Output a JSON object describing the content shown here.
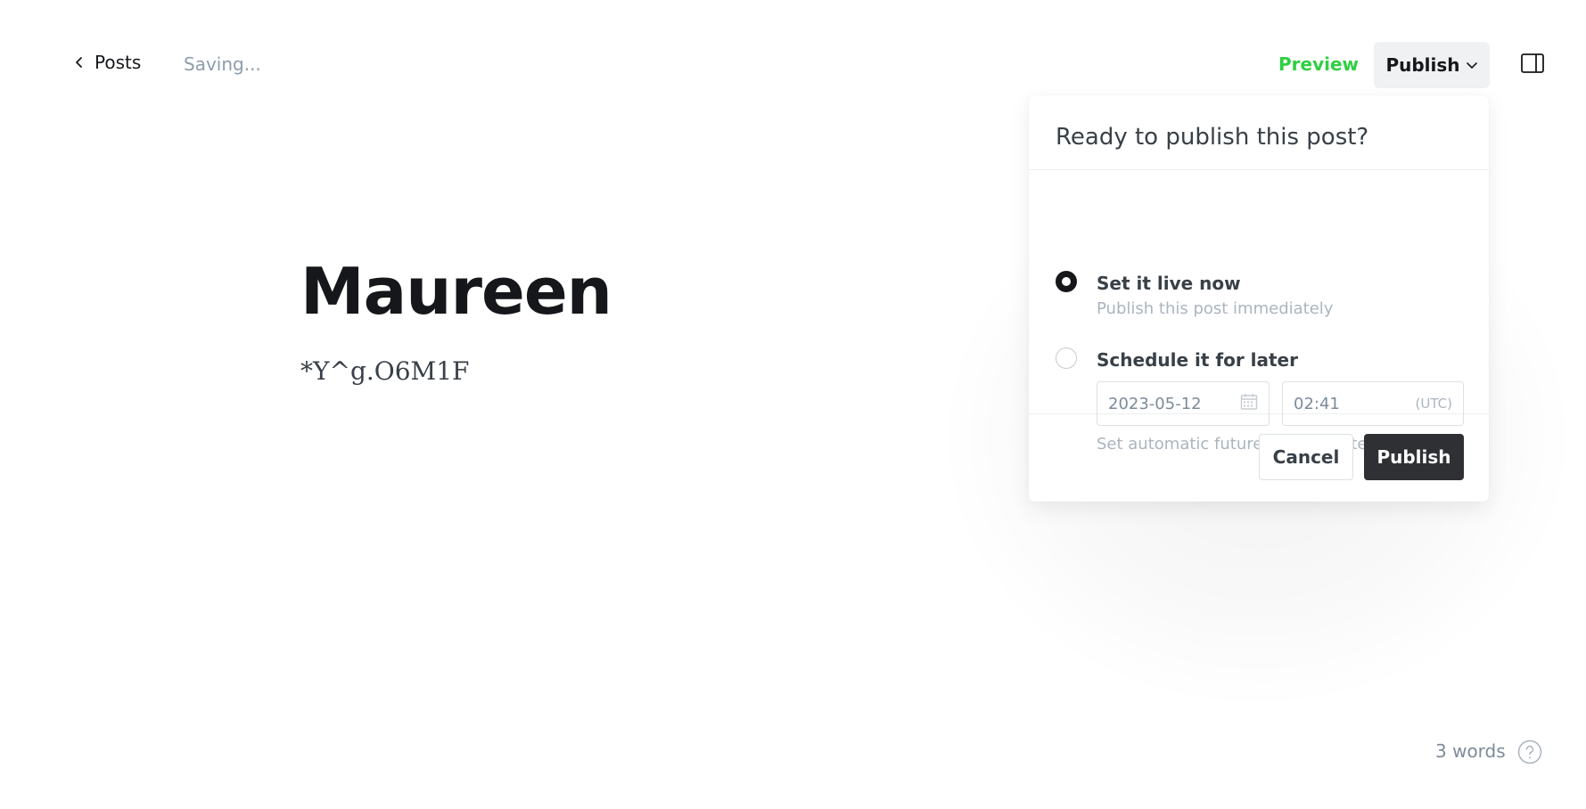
{
  "header": {
    "back_label": "Posts",
    "status": "Saving...",
    "preview_label": "Preview",
    "publish_label": "Publish"
  },
  "editor": {
    "title": "Maureen",
    "body": "*Y^g.O6M1F"
  },
  "publish_menu": {
    "heading": "Ready to publish this post?",
    "options": [
      {
        "label": "Set it live now",
        "description": "Publish this post immediately",
        "selected": true
      },
      {
        "label": "Schedule it for later",
        "description": "Set automatic future publish date",
        "selected": false
      }
    ],
    "date_value": "2023-05-12",
    "time_value": "02:41",
    "timezone": "(UTC)",
    "cancel_label": "Cancel",
    "confirm_label": "Publish"
  },
  "footer": {
    "word_count": "3 words"
  },
  "colors": {
    "accent_green": "#30cf43",
    "dark_button": "#2e3034",
    "muted_text": "#8e9cac"
  },
  "icons": {
    "back": "chevron-left-icon",
    "caret": "chevron-down-icon",
    "sidebar": "sidebar-panel-icon",
    "calendar": "calendar-icon",
    "help": "question-circle-icon"
  }
}
